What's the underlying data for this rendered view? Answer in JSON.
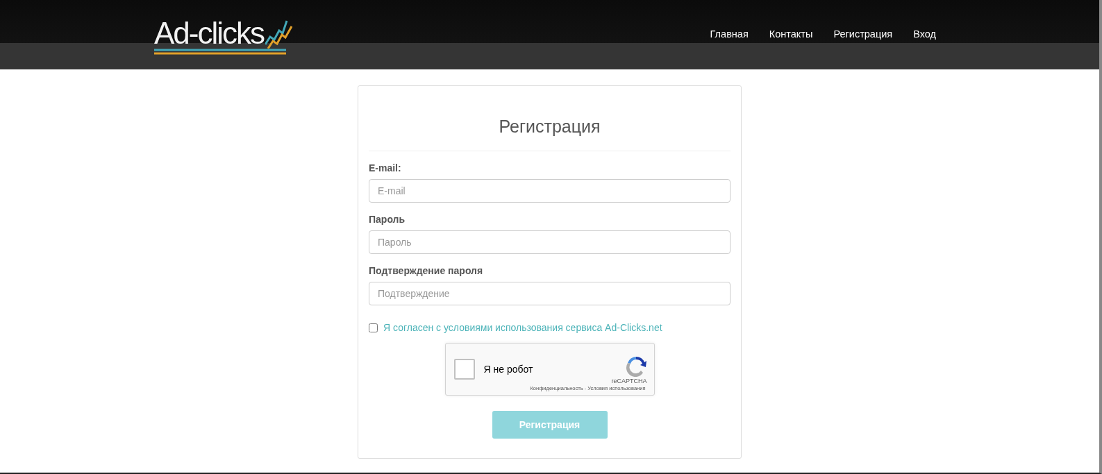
{
  "header": {
    "logo": "Ad-clicks",
    "nav": [
      {
        "label": "Главная"
      },
      {
        "label": "Контакты"
      },
      {
        "label": "Регистрация"
      },
      {
        "label": "Вход"
      }
    ]
  },
  "form": {
    "title": "Регистрация",
    "fields": [
      {
        "label": "E-mail:",
        "placeholder": "E-mail"
      },
      {
        "label": "Пароль",
        "placeholder": "Пароль"
      },
      {
        "label": "Подтверждение пароля",
        "placeholder": "Подтверждение"
      }
    ],
    "agree": {
      "label": "Я согласен с условиями использования сервиса Ad-Clicks.net",
      "checked": false
    },
    "captcha": {
      "label": "Я не робот",
      "checked": false,
      "brand": "reCAPTCHA",
      "links": "Конфиденциальность - Условия использования"
    },
    "submit": {
      "label": "Регистрация",
      "disabled": true
    }
  }
}
